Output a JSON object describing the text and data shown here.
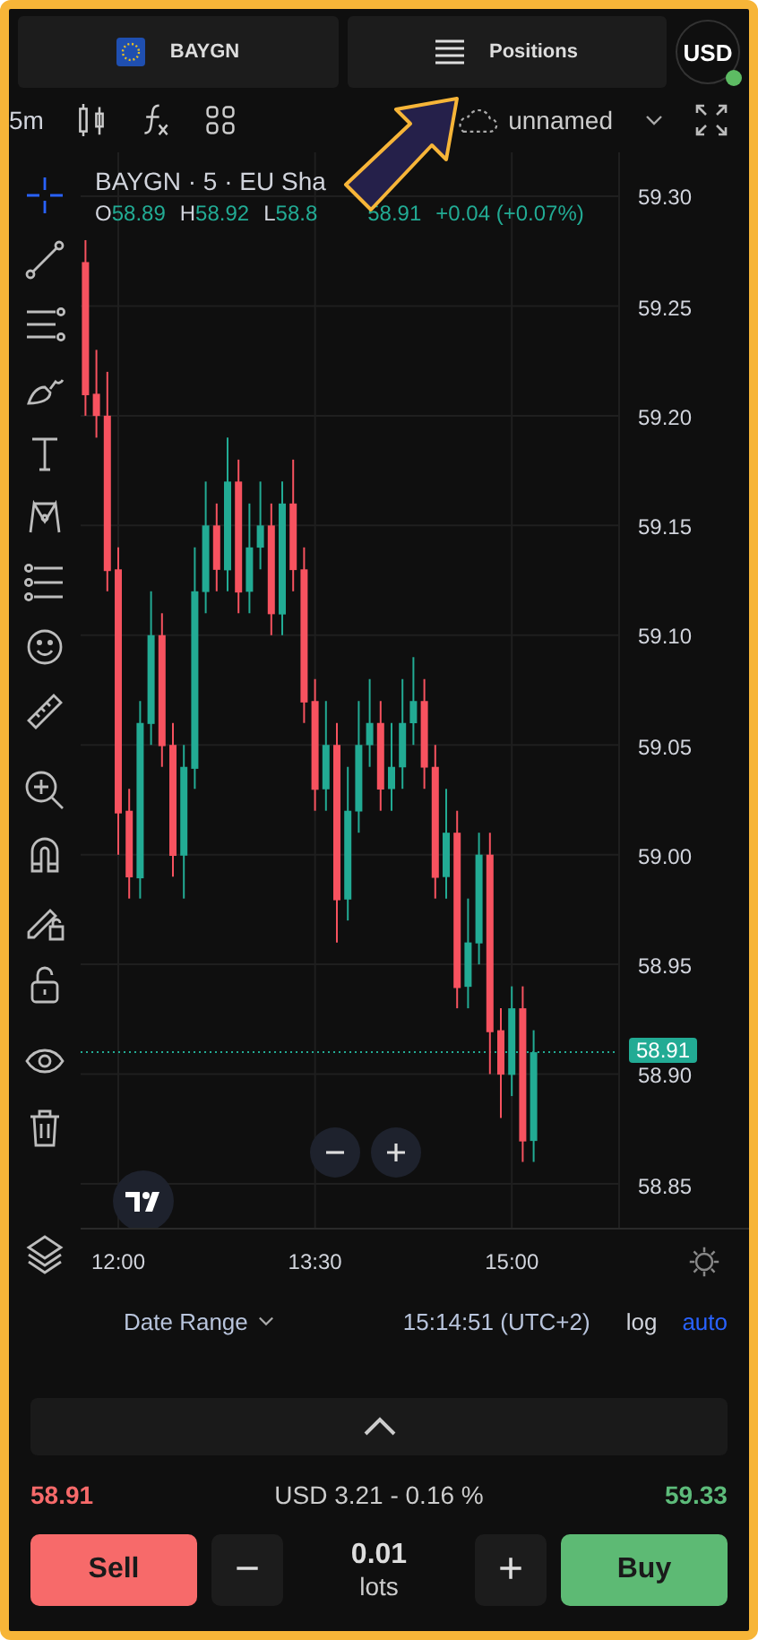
{
  "tabs": [
    {
      "label": "BAYGN",
      "selected": false
    },
    {
      "label": "Positions",
      "selected": false
    }
  ],
  "currency": {
    "label": "USD",
    "online": true
  },
  "toolbar": {
    "timeframe": "5m",
    "layout_name": "unnamed"
  },
  "drawing_tools": [
    {
      "selected": true
    },
    {
      "selected": false
    },
    {
      "selected": false
    },
    {
      "selected": false
    },
    {
      "selected": false
    },
    {
      "selected": false
    },
    {
      "selected": false
    },
    {
      "selected": false
    },
    {
      "selected": false
    },
    {
      "selected": false
    },
    {
      "selected": false
    },
    {
      "selected": false
    },
    {
      "selected": false
    },
    {
      "selected": false
    },
    {
      "selected": false
    }
  ],
  "legend": {
    "title": "BAYGN · 5 · EU Sha",
    "values": [
      {
        "prefix": "O",
        "value": "58.89"
      },
      {
        "prefix": "H",
        "value": "58.92"
      },
      {
        "prefix": "L",
        "value": "58.8"
      },
      {
        "value": "58.91"
      }
    ],
    "change": "+0.04 (+0.07%)"
  },
  "chart": {
    "chart_data": {
      "type": "candlestick",
      "categories": [
        null,
        null,
        null,
        "12:00",
        null,
        null,
        null,
        null,
        null,
        null,
        null,
        null,
        null,
        null,
        null,
        null,
        null,
        null,
        null,
        null,
        null,
        "13:30",
        null,
        null,
        null,
        null,
        null,
        null,
        null,
        null,
        null,
        null,
        null,
        null,
        null,
        null,
        null,
        null,
        null,
        "15:00",
        null,
        null
      ],
      "ohlc": [
        [
          59.27,
          59.28,
          59.2,
          59.21
        ],
        [
          59.21,
          59.23,
          59.19,
          59.2
        ],
        [
          59.2,
          59.22,
          59.12,
          59.13
        ],
        [
          59.13,
          59.14,
          59.0,
          59.02
        ],
        [
          59.02,
          59.03,
          58.98,
          58.99
        ],
        [
          58.99,
          59.07,
          58.98,
          59.06
        ],
        [
          59.06,
          59.12,
          59.05,
          59.1
        ],
        [
          59.1,
          59.11,
          59.04,
          59.05
        ],
        [
          59.05,
          59.06,
          58.99,
          59.0
        ],
        [
          59.0,
          59.05,
          58.98,
          59.04
        ],
        [
          59.04,
          59.14,
          59.03,
          59.12
        ],
        [
          59.12,
          59.17,
          59.11,
          59.15
        ],
        [
          59.15,
          59.16,
          59.12,
          59.13
        ],
        [
          59.13,
          59.19,
          59.12,
          59.17
        ],
        [
          59.17,
          59.18,
          59.11,
          59.12
        ],
        [
          59.12,
          59.16,
          59.11,
          59.14
        ],
        [
          59.14,
          59.17,
          59.13,
          59.15
        ],
        [
          59.15,
          59.16,
          59.1,
          59.11
        ],
        [
          59.11,
          59.17,
          59.1,
          59.16
        ],
        [
          59.16,
          59.18,
          59.12,
          59.13
        ],
        [
          59.13,
          59.14,
          59.06,
          59.07
        ],
        [
          59.07,
          59.08,
          59.02,
          59.03
        ],
        [
          59.03,
          59.07,
          59.02,
          59.05
        ],
        [
          59.05,
          59.06,
          58.96,
          58.98
        ],
        [
          58.98,
          59.04,
          58.97,
          59.02
        ],
        [
          59.02,
          59.07,
          59.01,
          59.05
        ],
        [
          59.05,
          59.08,
          59.04,
          59.06
        ],
        [
          59.06,
          59.07,
          59.02,
          59.03
        ],
        [
          59.03,
          59.06,
          59.02,
          59.04
        ],
        [
          59.04,
          59.08,
          59.03,
          59.06
        ],
        [
          59.06,
          59.09,
          59.05,
          59.07
        ],
        [
          59.07,
          59.08,
          59.03,
          59.04
        ],
        [
          59.04,
          59.05,
          58.98,
          58.99
        ],
        [
          58.99,
          59.03,
          58.98,
          59.01
        ],
        [
          59.01,
          59.02,
          58.93,
          58.94
        ],
        [
          58.94,
          58.98,
          58.93,
          58.96
        ],
        [
          58.96,
          59.01,
          58.95,
          59.0
        ],
        [
          59.0,
          59.01,
          58.9,
          58.92
        ],
        [
          58.92,
          58.93,
          58.88,
          58.9
        ],
        [
          58.9,
          58.94,
          58.89,
          58.93
        ],
        [
          58.93,
          58.94,
          58.86,
          58.87
        ],
        [
          58.87,
          58.92,
          58.86,
          58.91
        ]
      ],
      "ylim": [
        58.83,
        59.32
      ],
      "yticks": [
        {
          "value": 59.3,
          "label": "59.30"
        },
        {
          "value": 59.25,
          "label": "59.25"
        },
        {
          "value": 59.2,
          "label": "59.20"
        },
        {
          "value": 59.15,
          "label": "59.15"
        },
        {
          "value": 59.1,
          "label": "59.10"
        },
        {
          "value": 59.05,
          "label": "59.05"
        },
        {
          "value": 59.0,
          "label": "59.00"
        },
        {
          "value": 58.95,
          "label": "58.95"
        },
        {
          "value": 58.9,
          "label": "58.90"
        },
        {
          "value": 58.85,
          "label": "58.85"
        }
      ],
      "grid": true,
      "ref_lines": [
        {
          "axis": "y",
          "value": 58.91,
          "label": "58.91",
          "color": "#22ab94"
        }
      ]
    }
  },
  "footer": {
    "date_range": "Date Range",
    "clock": "15:14:51 (UTC+2)",
    "scale_modes": [
      {
        "label": "log",
        "selected": false
      },
      {
        "label": "auto",
        "selected": true
      }
    ]
  },
  "trade": {
    "sell_price": "58.91",
    "spread": "USD 3.21 - 0.16 %",
    "buy_price": "59.33",
    "sell": "Sell",
    "buy": "Buy",
    "quantity": "0.01",
    "unit": "lots",
    "minus": "−",
    "plus": "+"
  }
}
